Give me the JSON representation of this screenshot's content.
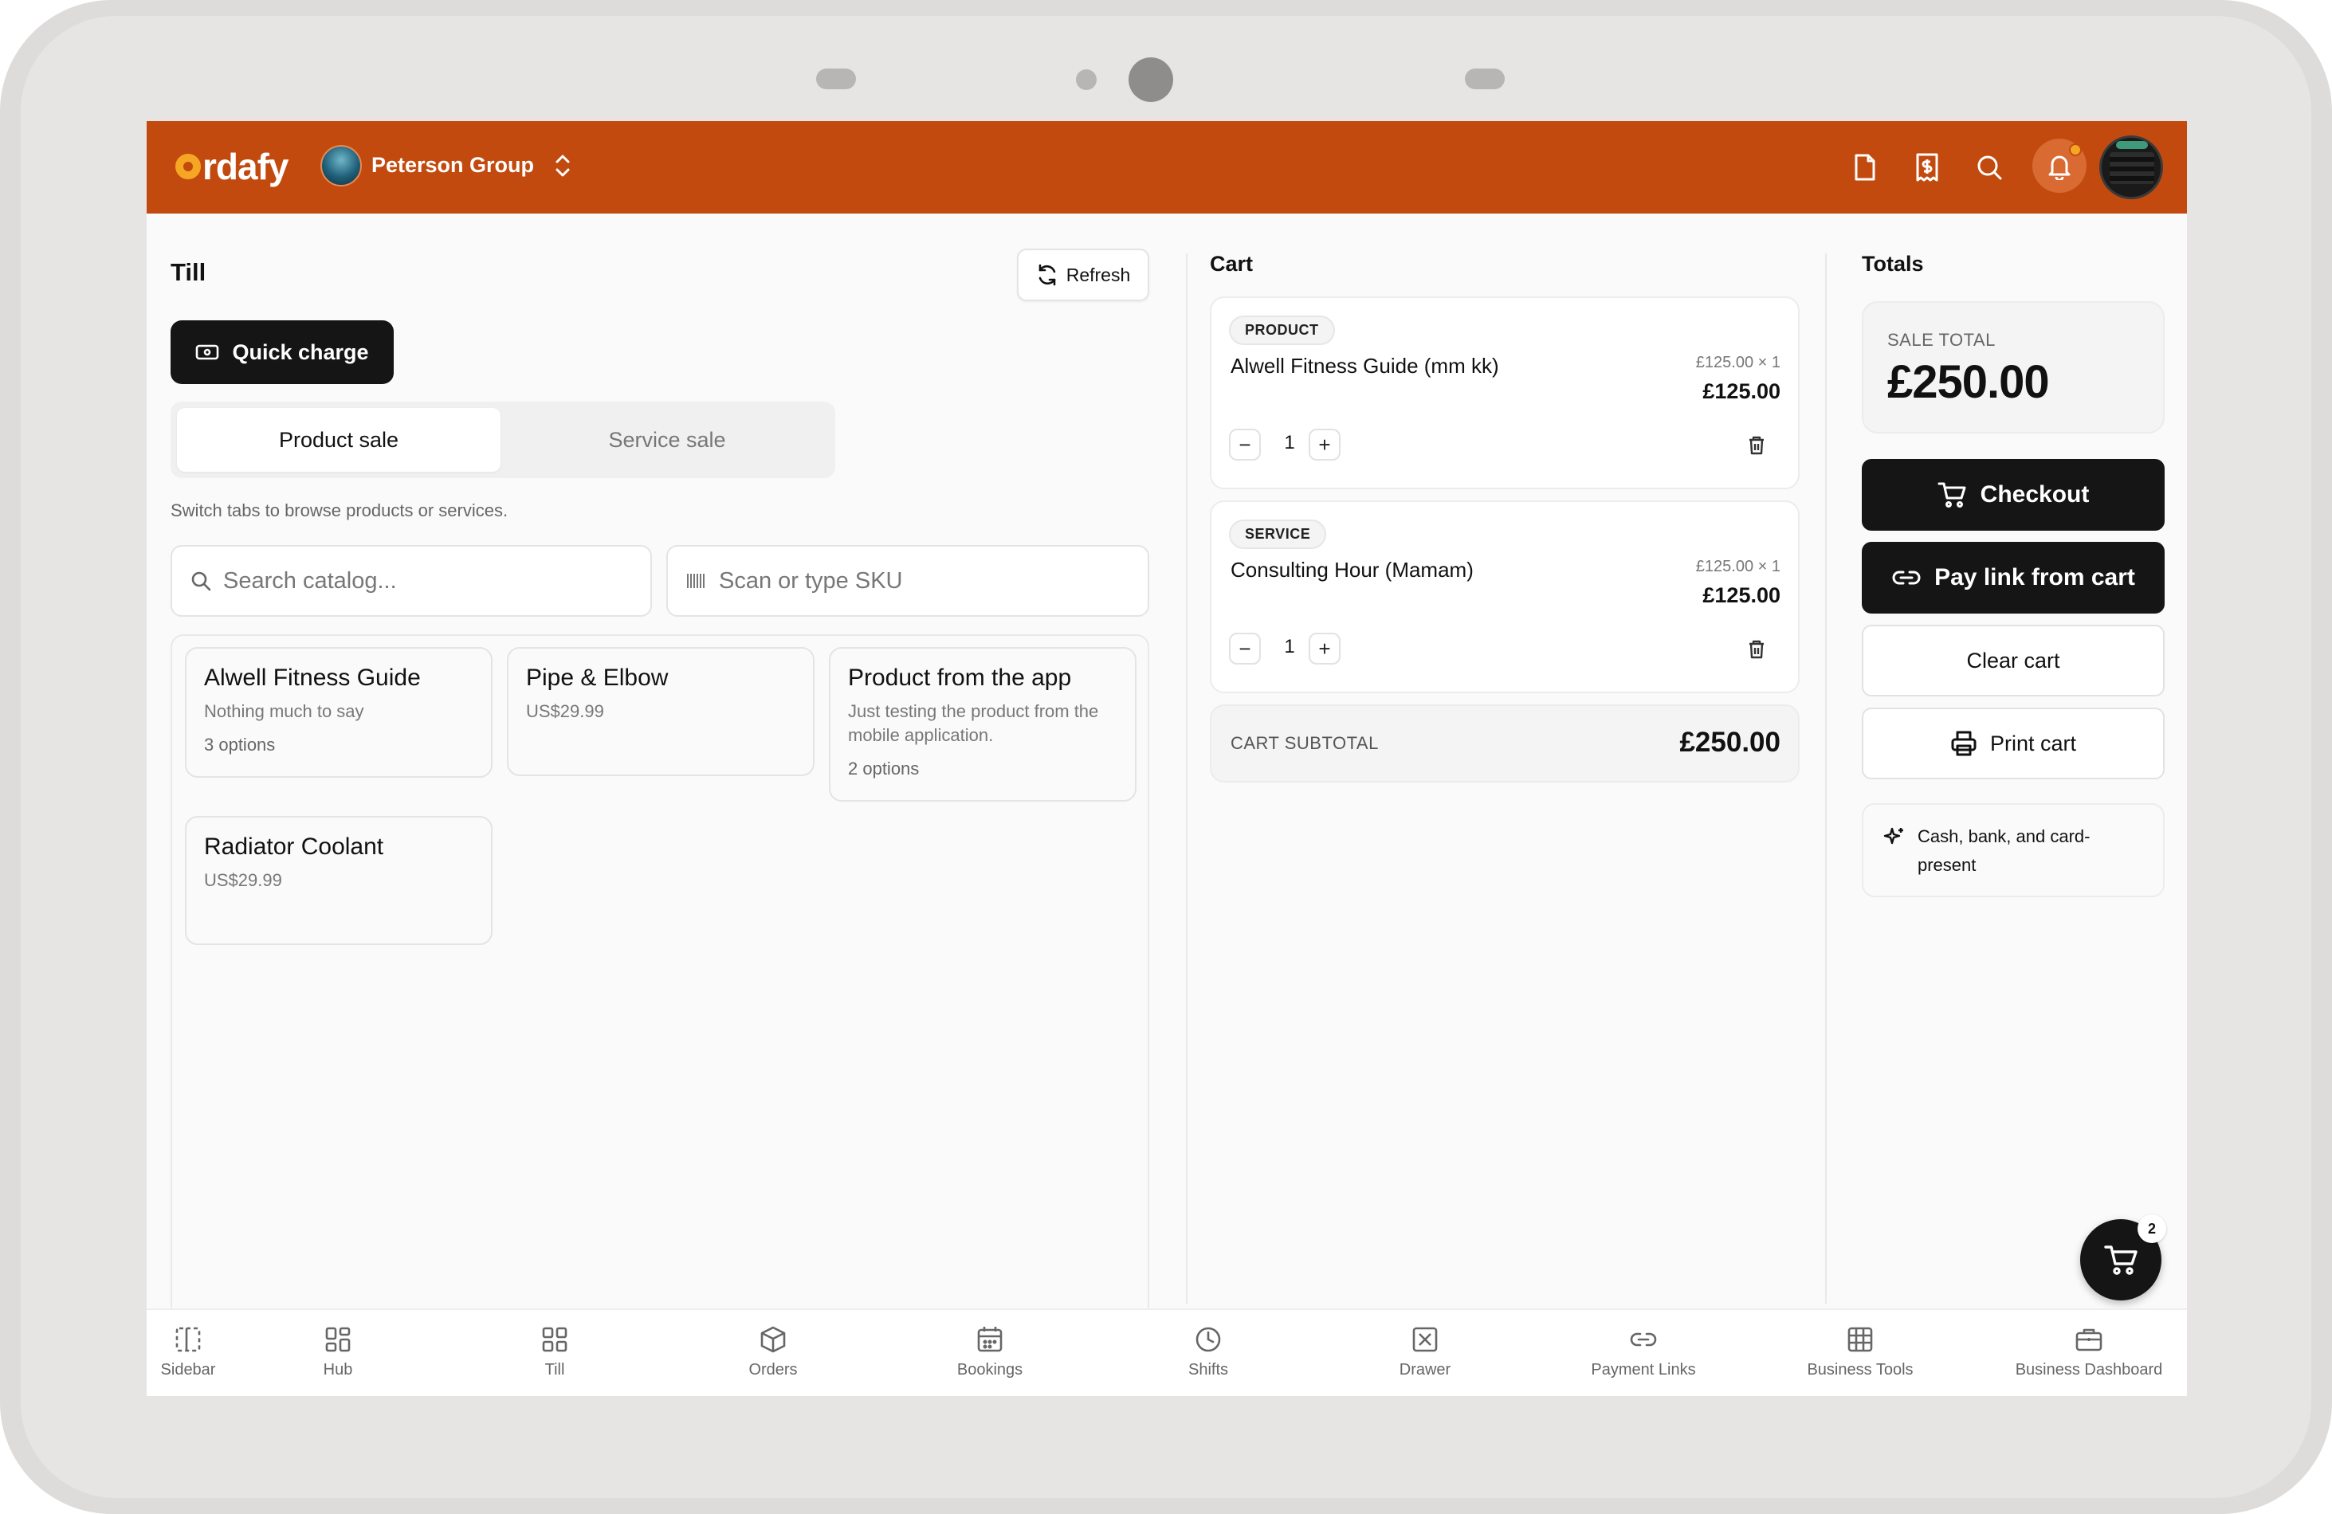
{
  "header": {
    "brand": "rdafy",
    "org_name": "Peterson Group"
  },
  "till": {
    "title": "Till",
    "refresh_label": "Refresh",
    "quick_charge_label": "Quick charge",
    "tabs": [
      {
        "label": "Product sale",
        "active": true
      },
      {
        "label": "Service sale",
        "active": false
      }
    ],
    "hint": "Switch tabs to browse products or services.",
    "search_placeholder": "Search catalog...",
    "sku_placeholder": "Scan or type SKU",
    "products": [
      {
        "name": "Alwell Fitness Guide",
        "desc": "Nothing much to say",
        "options": "3 options"
      },
      {
        "name": "Pipe & Elbow",
        "desc": "US$29.99",
        "options": ""
      },
      {
        "name": "Product from the app",
        "desc": "Just testing the product from the mobile application.",
        "options": "2 options"
      },
      {
        "name": "Radiator Coolant",
        "desc": "US$29.99",
        "options": ""
      }
    ]
  },
  "cart": {
    "title": "Cart",
    "items": [
      {
        "type": "PRODUCT",
        "name": "Alwell Fitness Guide (mm kk)",
        "unit": "£125.00 × 1",
        "price": "£125.00",
        "qty": "1"
      },
      {
        "type": "SERVICE",
        "name": "Consulting Hour (Mamam)",
        "unit": "£125.00 × 1",
        "price": "£125.00",
        "qty": "1"
      }
    ],
    "subtotal_label": "CART SUBTOTAL",
    "subtotal_value": "£250.00"
  },
  "totals": {
    "title": "Totals",
    "sale_total_label": "SALE TOTAL",
    "sale_total_value": "£250.00",
    "checkout_label": "Checkout",
    "pay_link_label": "Pay link from cart",
    "clear_label": "Clear cart",
    "print_label": "Print cart",
    "note": "Cash, bank, and card-present"
  },
  "fab": {
    "count": "2"
  },
  "nav": [
    {
      "label": "Sidebar",
      "icon": "sidebar-icon"
    },
    {
      "label": "Hub",
      "icon": "grid-icon"
    },
    {
      "label": "Till",
      "icon": "grid-icon"
    },
    {
      "label": "Orders",
      "icon": "box-icon"
    },
    {
      "label": "Bookings",
      "icon": "calendar-icon"
    },
    {
      "label": "Shifts",
      "icon": "clock-icon"
    },
    {
      "label": "Drawer",
      "icon": "drawer-icon"
    },
    {
      "label": "Payment Links",
      "icon": "link-icon"
    },
    {
      "label": "Business Tools",
      "icon": "table-icon"
    },
    {
      "label": "Business Dashboard",
      "icon": "briefcase-icon"
    }
  ],
  "colors": {
    "brand": "#c24a0f",
    "dark_button": "#151515"
  }
}
